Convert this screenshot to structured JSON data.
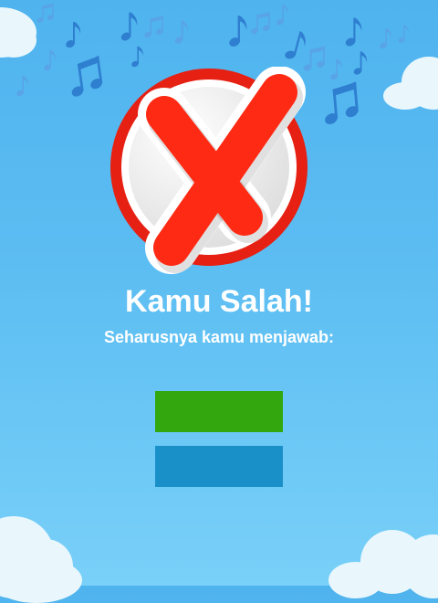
{
  "result": {
    "title": "Kamu Salah!",
    "subtitle": "Seharusnya kamu menjawab:"
  },
  "answers": [
    {
      "label": "",
      "color": "#33a80e"
    },
    {
      "label": "",
      "color": "#1a90c9"
    }
  ],
  "colors": {
    "sky_top": "#4fb3ee",
    "sky_bottom": "#79d0f8",
    "cloud": "#e9f7fd",
    "note": "#2f7fd0",
    "badge_red": "#e62012",
    "cross_red": "#ff2a14"
  },
  "icons": [
    "music-note-icon",
    "wrong-answer-icon"
  ]
}
